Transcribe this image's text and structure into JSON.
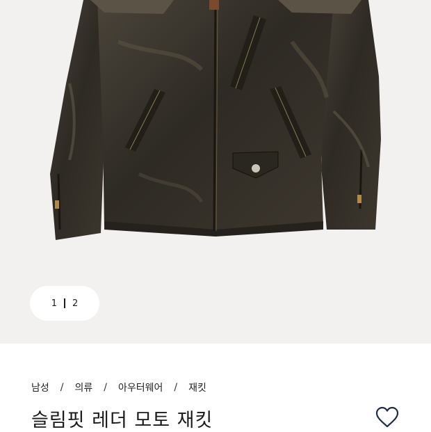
{
  "gallery": {
    "image_label": "leather-moto-jacket-photo",
    "pager": {
      "current": "1",
      "total": "2"
    }
  },
  "breadcrumb": [
    "남성",
    "의류",
    "아우터웨어",
    "재킷"
  ],
  "breadcrumb_separator": "/",
  "product": {
    "title": "슬림핏 레더 모토 재킷"
  },
  "icons": {
    "wishlist": "heart-icon"
  },
  "colors": {
    "gallery_bg": "#f2f1f0",
    "text": "#1a1a1a",
    "leather": "#3a352d"
  }
}
